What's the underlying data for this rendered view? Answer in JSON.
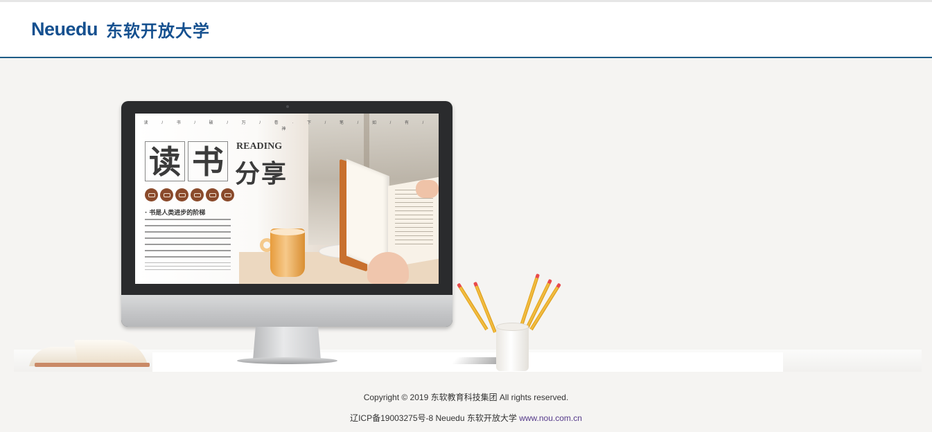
{
  "header": {
    "logo_en": "Neuedu",
    "logo_cn": "东软开放大学"
  },
  "hero": {
    "screen": {
      "top_line": "读 / 书 / 破 / 万 / 卷 · 下 / 笔 / 如 / 有 / 神",
      "title_char_1": "读",
      "title_char_2": "书",
      "reading": "READING",
      "share": "分享",
      "subtitle": "· 书是人类进步的阶梯"
    }
  },
  "footer": {
    "copyright": "Copyright © 2019 东软教育科技集团 All rights reserved.",
    "icp_text": "辽ICP备19003275号-8 Neuedu 东软开放大学 ",
    "site_link": "www.nou.com.cn"
  }
}
